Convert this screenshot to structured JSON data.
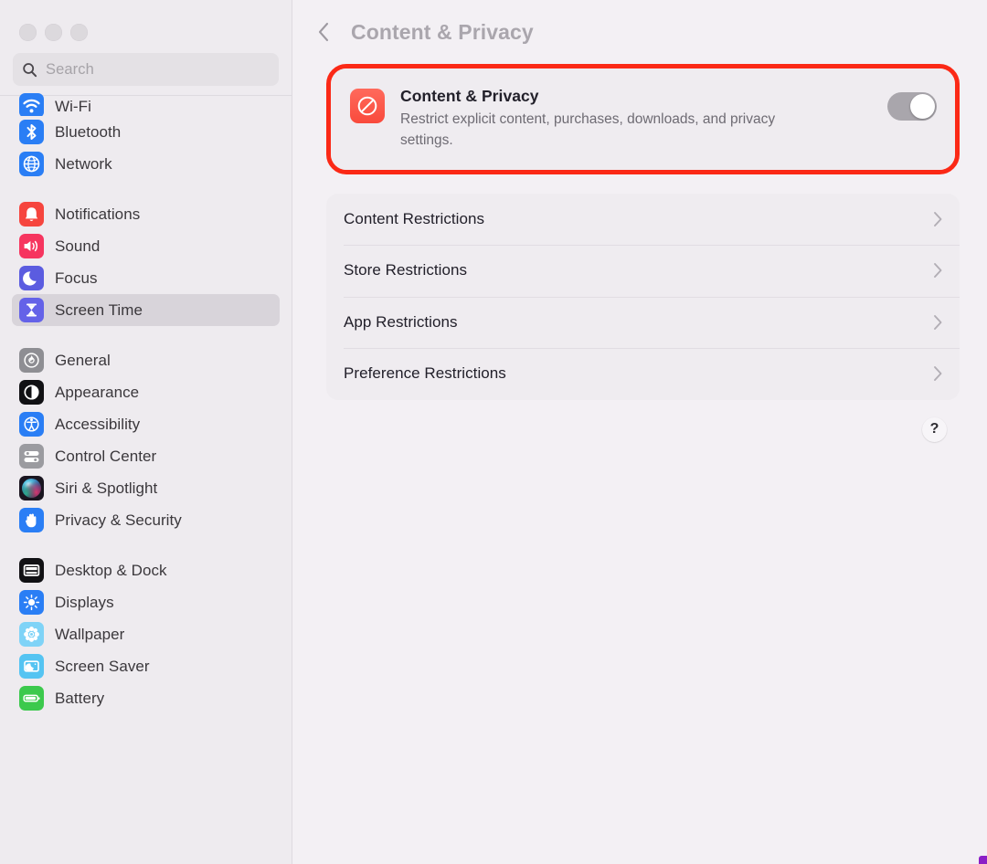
{
  "window": {
    "traffic_lights": [
      "close",
      "minimize",
      "zoom"
    ],
    "state": "inactive"
  },
  "sidebar": {
    "search": {
      "placeholder": "Search",
      "value": "",
      "icon": "search-icon"
    },
    "groups": [
      {
        "items": [
          {
            "label": "Wi-Fi",
            "icon": "wifi-icon",
            "selected": false,
            "clipped": true
          },
          {
            "label": "Bluetooth",
            "icon": "bluetooth-icon",
            "selected": false
          },
          {
            "label": "Network",
            "icon": "network-globe-icon",
            "selected": false
          }
        ]
      },
      {
        "items": [
          {
            "label": "Notifications",
            "icon": "notifications-bell-icon",
            "selected": false
          },
          {
            "label": "Sound",
            "icon": "sound-speaker-icon",
            "selected": false
          },
          {
            "label": "Focus",
            "icon": "focus-moon-icon",
            "selected": false
          },
          {
            "label": "Screen Time",
            "icon": "screen-time-hourglass-icon",
            "selected": true
          }
        ]
      },
      {
        "items": [
          {
            "label": "General",
            "icon": "general-gear-icon",
            "selected": false
          },
          {
            "label": "Appearance",
            "icon": "appearance-contrast-icon",
            "selected": false
          },
          {
            "label": "Accessibility",
            "icon": "accessibility-person-icon",
            "selected": false
          },
          {
            "label": "Control Center",
            "icon": "control-center-sliders-icon",
            "selected": false
          },
          {
            "label": "Siri & Spotlight",
            "icon": "siri-orb-icon",
            "selected": false
          },
          {
            "label": "Privacy & Security",
            "icon": "privacy-hand-icon",
            "selected": false
          }
        ]
      },
      {
        "items": [
          {
            "label": "Desktop & Dock",
            "icon": "desktop-dock-icon",
            "selected": false
          },
          {
            "label": "Displays",
            "icon": "displays-brightness-icon",
            "selected": false
          },
          {
            "label": "Wallpaper",
            "icon": "wallpaper-flower-icon",
            "selected": false
          },
          {
            "label": "Screen Saver",
            "icon": "screen-saver-icon",
            "selected": false
          },
          {
            "label": "Battery",
            "icon": "battery-icon",
            "selected": false
          }
        ]
      }
    ]
  },
  "main": {
    "back_button": "chevron-left-icon",
    "title": "Content & Privacy",
    "privacy_card": {
      "icon": "prohibited-sign-icon",
      "title": "Content & Privacy",
      "description": "Restrict explicit content, purchases, downloads, and privacy settings.",
      "toggle": {
        "name": "content-privacy-toggle",
        "state": "on",
        "enabled": false
      },
      "highlighted": true,
      "highlight_color": "#fb2916"
    },
    "restrictions": [
      {
        "label": "Content Restrictions"
      },
      {
        "label": "Store Restrictions"
      },
      {
        "label": "App Restrictions"
      },
      {
        "label": "Preference Restrictions"
      }
    ],
    "help_button": "?"
  },
  "colors": {
    "sidebar_bg": "#eeebef",
    "main_bg": "#f3f0f4",
    "card_bg": "#efecf0",
    "selected_row": "#d8d4da",
    "accent_red": "#fb2916",
    "title_text": "#aaa6ad",
    "body_text": "#22202a",
    "secondary_text": "#6e6b73"
  }
}
